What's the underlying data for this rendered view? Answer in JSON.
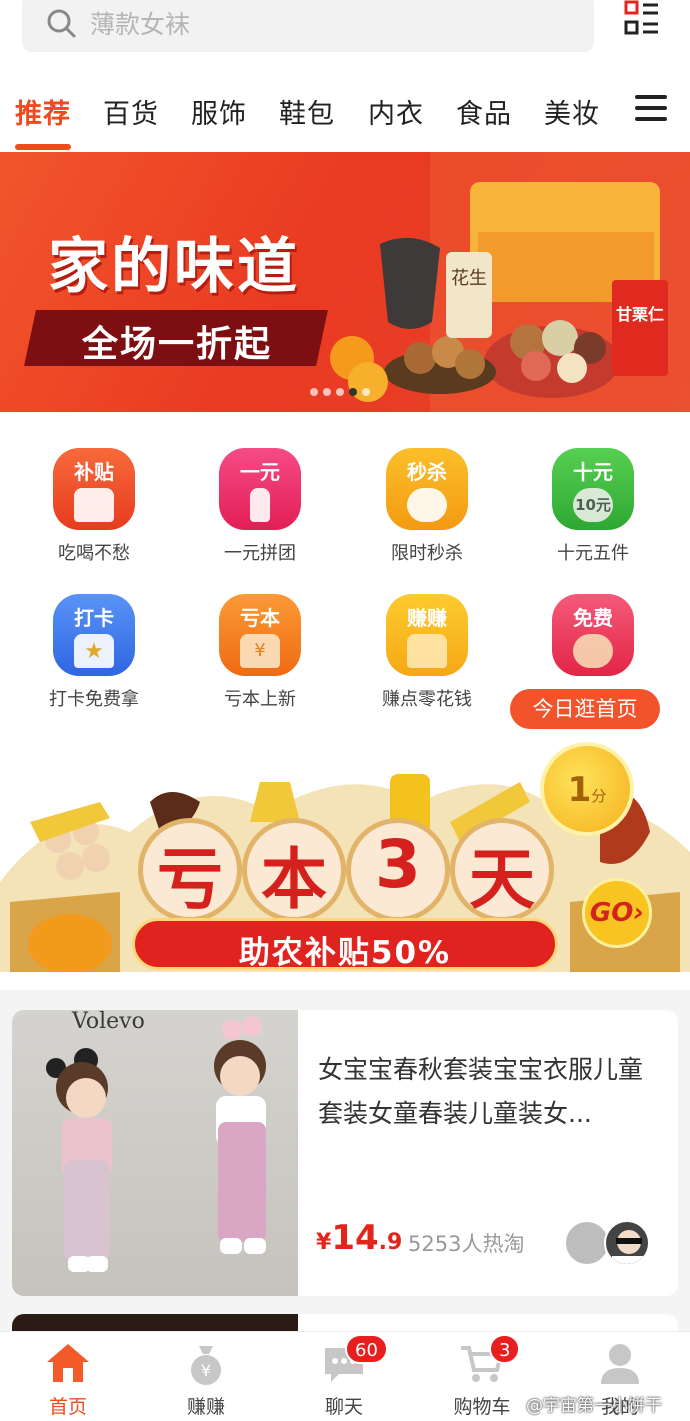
{
  "search": {
    "placeholder": "薄款女袜",
    "icon": "search-icon",
    "right_icon": "scan-list-icon"
  },
  "tabs": [
    {
      "label": "推荐",
      "active": true
    },
    {
      "label": "百货"
    },
    {
      "label": "服饰"
    },
    {
      "label": "鞋包"
    },
    {
      "label": "内衣"
    },
    {
      "label": "食品"
    },
    {
      "label": "美妆"
    }
  ],
  "menu_icon": "hamburger-menu-icon",
  "banner": {
    "title": "家的味道",
    "subtitle": "全场一折起",
    "slides": 5,
    "active_slide": 4
  },
  "grid": [
    {
      "tag": "补贴",
      "label": "吃喝不愁",
      "color": "#f2532b"
    },
    {
      "tag": "一元",
      "label": "一元拼团",
      "color": "#ee2f6b"
    },
    {
      "tag": "秒杀",
      "label": "限时秒杀",
      "color": "#f7a21b"
    },
    {
      "tag": "十元",
      "label": "十元五件",
      "color": "#3fbd42",
      "coin_text": "10元"
    },
    {
      "tag": "打卡",
      "label": "打卡免费拿",
      "color": "#3d7df0"
    },
    {
      "tag": "亏本",
      "label": "亏本上新",
      "color": "#f4801f"
    },
    {
      "tag": "赚赚",
      "label": "赚点零花钱",
      "color": "#f9b51a"
    },
    {
      "tag": "免费",
      "label": "",
      "color": "#ec3453"
    }
  ],
  "pill": {
    "label": "今日逛首页"
  },
  "promo": {
    "chars": [
      "亏",
      "本",
      "3",
      "天"
    ],
    "subtitle": "助农补贴50%",
    "coin_num": "1",
    "coin_unit": "分",
    "go_label": "GO"
  },
  "product": {
    "title": "女宝宝春秋套装宝宝衣服儿童套装女童春装儿童装女...",
    "currency": "¥",
    "price_int": "14",
    "price_dec": ".9",
    "sold": "5253人热淘",
    "photo_text": "Volevo"
  },
  "nav": [
    {
      "label": "首页",
      "icon": "home-icon",
      "active": true
    },
    {
      "label": "赚赚",
      "icon": "money-bag-icon"
    },
    {
      "label": "聊天",
      "icon": "chat-icon",
      "badge": "60"
    },
    {
      "label": "购物车",
      "icon": "cart-icon",
      "badge": "3"
    },
    {
      "label": "我的",
      "icon": "profile-icon"
    }
  ],
  "watermark": "@宇宙第一小饼干",
  "colors": {
    "accent": "#f2491d",
    "price": "#e1251b"
  }
}
